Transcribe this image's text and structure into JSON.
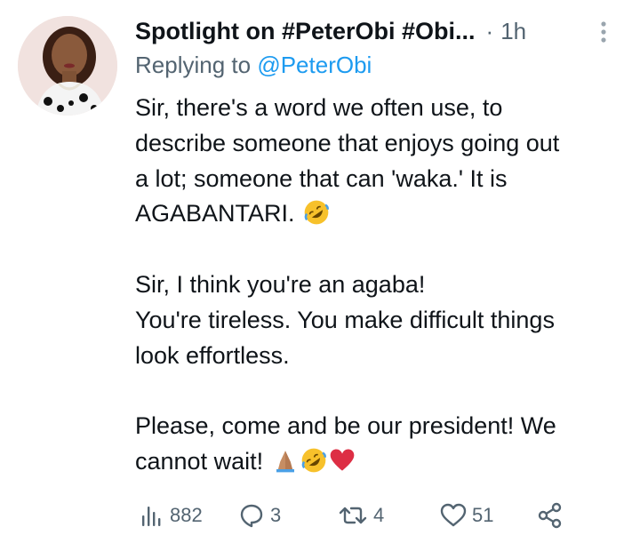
{
  "tweet": {
    "display_name": "Spotlight on #PeterObi #Obi...",
    "separator": "·",
    "timestamp": "1h",
    "reply_prefix": "Replying to",
    "reply_handle": "@PeterObi",
    "lines": [
      "Sir, there's a word we often use, to",
      "describe someone that enjoys going out",
      "a lot; someone that can 'waka.' It is",
      "AGABANTARI.",
      "",
      "Sir, I think you're an agaba!",
      "You're tireless. You make difficult things",
      "look effortless.",
      "",
      "Please, come and be our president! We",
      "cannot wait!"
    ],
    "emojis": {
      "line4": [
        "rolling-on-floor-laughing-emoji"
      ],
      "line11": [
        "folded-hands-emoji",
        "rolling-on-floor-laughing-emoji",
        "red-heart-emoji"
      ]
    }
  },
  "actions": {
    "views_count": "882",
    "replies_count": "3",
    "retweets_count": "4",
    "likes_count": "51"
  },
  "colors": {
    "text": "#0f1419",
    "secondary": "#536471",
    "link": "#1d9bf0",
    "heart": "#e0245e"
  }
}
